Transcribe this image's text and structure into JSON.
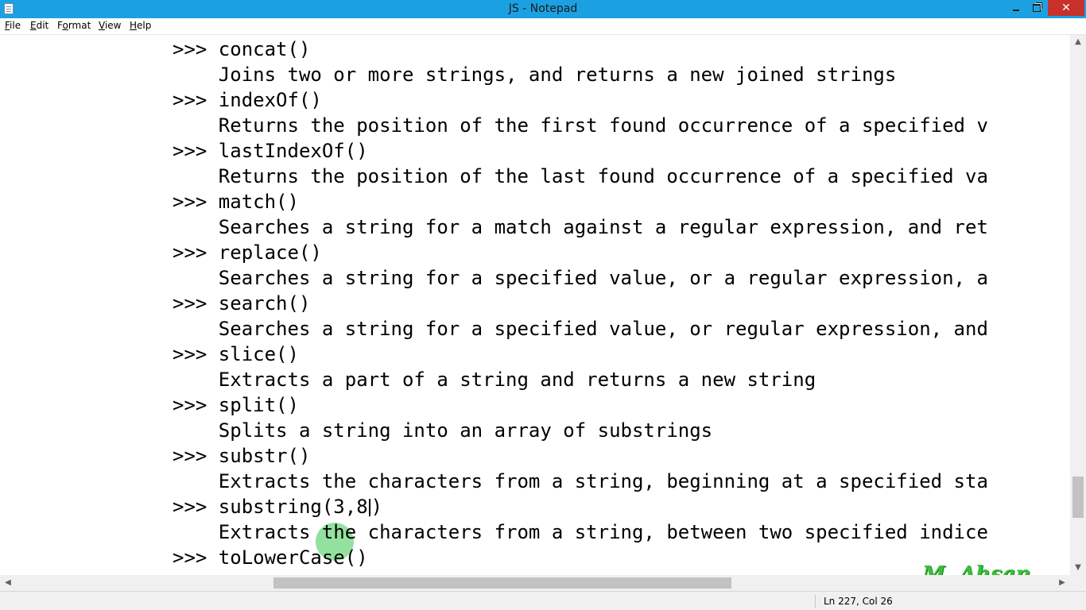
{
  "window": {
    "title": "JS - Notepad",
    "close_glyph": "✕"
  },
  "menu": {
    "items": [
      {
        "label": "File",
        "underline": "F",
        "rest": "ile"
      },
      {
        "label": "Edit",
        "underline": "E",
        "rest": "dit"
      },
      {
        "label": "Format",
        "underline": "o",
        "pre": "F",
        "rest": "rmat"
      },
      {
        "label": "View",
        "underline": "V",
        "rest": "iew"
      },
      {
        "label": "Help",
        "underline": "H",
        "rest": "elp"
      }
    ]
  },
  "editor": {
    "lines": [
      ">>> concat()",
      "    Joins two or more strings, and returns a new joined strings",
      ">>> indexOf()",
      "    Returns the position of the first found occurrence of a specified v",
      ">>> lastIndexOf()",
      "    Returns the position of the last found occurrence of a specified va",
      ">>> match()",
      "    Searches a string for a match against a regular expression, and ret",
      ">>> replace()",
      "    Searches a string for a specified value, or a regular expression, a",
      ">>> search()",
      "    Searches a string for a specified value, or regular expression, and",
      ">>> slice()",
      "    Extracts a part of a string and returns a new string",
      ">>> split()",
      "    Splits a string into an array of substrings",
      ">>> substr()",
      "    Extracts the characters from a string, beginning at a specified sta",
      "",
      "    Extracts the characters from a string, between two specified indice",
      ">>> toLowerCase()"
    ],
    "editing_line_before": ">>> substring(3,8",
    "editing_line_after": ")",
    "watermark": "M. Ahsan"
  },
  "status": {
    "position": "Ln 227, Col 26"
  },
  "colors": {
    "titlebar": "#1ba1e2",
    "close": "#c7312a",
    "cursor_highlight": "#3cc850",
    "watermark": "#3bbf3b"
  },
  "icons": {
    "app": "notepad-icon",
    "minimize": "minimize-icon",
    "maximize": "restore-icon",
    "close": "close-icon"
  }
}
